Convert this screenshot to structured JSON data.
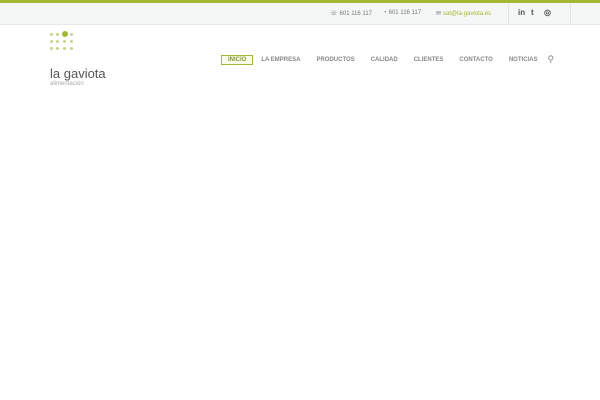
{
  "topbar": {
    "phone": "601 116 117",
    "whatsapp": "601 116 117",
    "email": "sat@la-gaviota.es",
    "social": [
      "linkedin-icon",
      "twitter-icon",
      "whatsapp-icon"
    ]
  },
  "brand": {
    "name": "la gaviota",
    "tagline": "alimentación"
  },
  "nav": [
    "INICIO",
    "LA EMPRESA",
    "PRODUCTOS",
    "CALIDAD",
    "CLIENTES",
    "CONTACTO",
    "NOTICIAS"
  ],
  "colors": {
    "accent": "#a3b830"
  }
}
